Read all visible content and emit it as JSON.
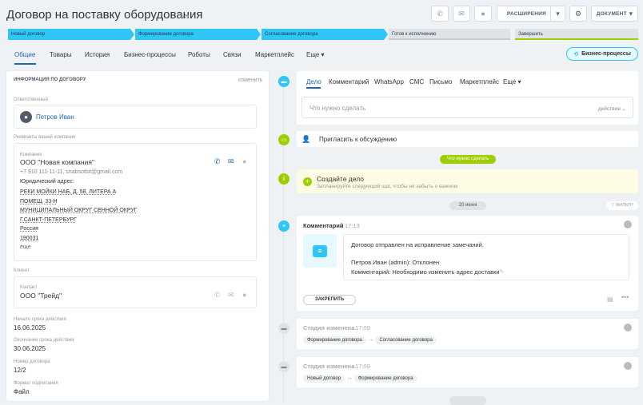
{
  "header": {
    "title": "Договор на поставку оборудования",
    "extensions_label": "РАСШИРЕНИЯ",
    "document_label": "ДОКУМЕНТ"
  },
  "stages": [
    "Новый договор",
    "Формирование договора",
    "Согласование договора",
    "Готов к исполнению",
    "Завершить"
  ],
  "tabs": [
    "Общие",
    "Товары",
    "История",
    "Бизнес-процессы",
    "Роботы",
    "Связи",
    "Маркетплейс",
    "Еще"
  ],
  "bp_button": "Бизнес-процессы",
  "left": {
    "section_title": "ИНФОРМАЦИЯ ПО ДОГОВОРУ",
    "edit_label": "изменить",
    "responsible_label": "Ответственный",
    "responsible_name": "Петров Иван",
    "company_req_label": "Реквизиты вашей компании",
    "company_label": "Компания",
    "company_name": "ООО \"Новая компания\"",
    "company_contacts": "+7 910 111-11-11, snabsotbit@gmail.com",
    "legal_address_label": "Юридический адрес:",
    "address_lines": [
      "РЕКИ МОЙКИ НАБ, Д. 58, ЛИТЕРА А",
      "ПОМЕЩ. 33-Н",
      "МУНИЦИПАЛЬНЫЙ ОКРУГ СЕННОЙ ОКРУГ",
      "Г.САНКТ-ПЕТЕРБУРГ",
      "Россия",
      "190031"
    ],
    "more_label": "еще",
    "client_label": "Клиент",
    "contact_label": "Контакт",
    "contact_name": "ООО \"Трейд\"",
    "start_label": "Начало срока действия",
    "start_value": "16.06.2025",
    "end_label": "Окончание срока действия",
    "end_value": "30.06.2025",
    "number_label": "Номер договора",
    "number_value": "12/2",
    "format_label": "Формат подписания",
    "format_value": "Файл"
  },
  "activity": {
    "tabs": [
      "Дело",
      "Комментарий",
      "WhatsApp",
      "СМС",
      "Письмо",
      "Маркетплейс",
      "Еще"
    ],
    "placeholder": "Что нужно сделать",
    "actions_label": "действия"
  },
  "timeline": {
    "invite_label": "Пригласить к обсуждению",
    "todo_badge": "Что нужно сделать",
    "create_title": "Создайте дело",
    "create_hint": "Запланируйте следующий шаг, чтобы не забыть о важном",
    "date_badge": "20 июня",
    "filter_label": "ФИЛЬТР",
    "comment_title": "Комментарий",
    "comment_time": "17:13",
    "comment_line1": "Договор отправлен на исправление замечаний.",
    "comment_line2": "Петров Иван (admin): Отклонен",
    "comment_line3": "Комментарий: Необходимо изменить адрес доставки",
    "pin_label": "ЗАКРЕПИТЬ",
    "stage1_title": "Стадия изменена",
    "stage1_time": "17:09",
    "stage1_from": "Формирование договора",
    "stage1_to": "Согласование договора",
    "stage2_title": "Стадия изменена",
    "stage2_time": "17:09",
    "stage2_from": "Новый договор",
    "stage2_to": "Формирование договора"
  },
  "colors": {
    "accent": "#2fc6f6",
    "green": "#9dcf00",
    "blue": "#2067b0"
  }
}
